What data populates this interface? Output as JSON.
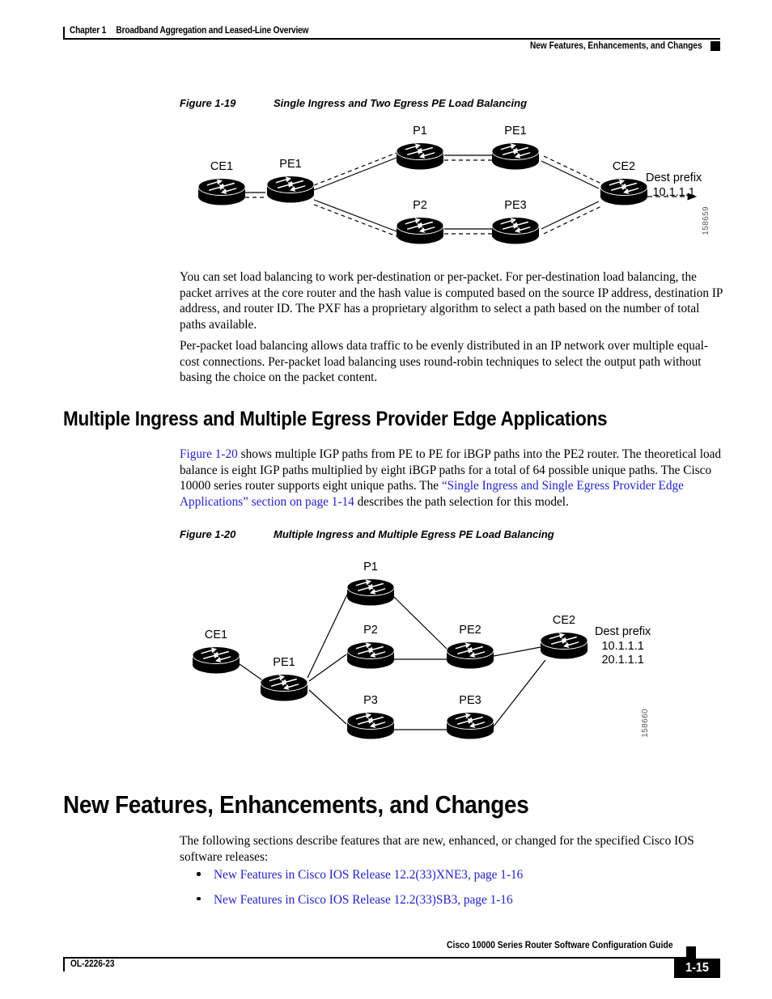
{
  "header": {
    "chapter_label": "Chapter 1",
    "chapter_title": "Broadband Aggregation and Leased-Line Overview",
    "section_title": "New Features, Enhancements, and Changes"
  },
  "figure_19": {
    "number": "Figure 1-19",
    "title": "Single Ingress and Two Egress PE Load Balancing",
    "figure_id": "158659",
    "nodes": [
      {
        "name": "CE1",
        "label": "CE1"
      },
      {
        "name": "PE1-ingress",
        "label": "PE1"
      },
      {
        "name": "P1",
        "label": "P1"
      },
      {
        "name": "P2",
        "label": "P2"
      },
      {
        "name": "PE1-egress",
        "label": "PE1"
      },
      {
        "name": "PE3",
        "label": "PE3"
      },
      {
        "name": "CE2",
        "label": "CE2"
      }
    ],
    "annotation": {
      "line1": "Dest prefix",
      "line2": "10.1.1.1"
    }
  },
  "paragraphs": {
    "per_destination": "You can set load balancing to work per-destination or per-packet. For per-destination load balancing, the packet arrives at the core router and the hash value is computed based on the source IP address, destination IP address, and router ID. The PXF has a proprietary algorithm to select a path based on the number of total paths available.",
    "per_packet": "Per-packet load balancing allows data traffic to be evenly distributed in an IP network over multiple equal-cost connections. Per-packet load balancing uses round-robin techniques to select the output path without basing the choice on the packet content."
  },
  "section_multiple": {
    "heading": "Multiple Ingress and Multiple Egress Provider Edge Applications",
    "intro": {
      "link_figure": "Figure 1-20",
      "text_1": " shows multiple IGP paths from PE to PE for iBGP paths into the PE2 router. The theoretical load balance is eight IGP paths multiplied by eight iBGP paths for a total of 64 possible unique paths. The Cisco 10000 series router supports eight unique paths. The ",
      "link_section": "“Single Ingress and Single Egress Provider Edge Applications” section on page 1-14",
      "text_2": " describes the path selection for this model."
    }
  },
  "figure_20": {
    "number": "Figure 1-20",
    "title": "Multiple Ingress and Multiple Egress PE Load Balancing",
    "figure_id": "158660",
    "nodes": [
      {
        "name": "CE1",
        "label": "CE1"
      },
      {
        "name": "PE1",
        "label": "PE1"
      },
      {
        "name": "P1",
        "label": "P1"
      },
      {
        "name": "P2",
        "label": "P2"
      },
      {
        "name": "P3",
        "label": "P3"
      },
      {
        "name": "PE2",
        "label": "PE2"
      },
      {
        "name": "PE3",
        "label": "PE3"
      },
      {
        "name": "CE2",
        "label": "CE2"
      }
    ],
    "annotation": {
      "line1": "Dest prefix",
      "line2": "10.1.1.1",
      "line3": "20.1.1.1"
    }
  },
  "section_new_features": {
    "heading": "New Features, Enhancements, and Changes",
    "intro": "The following sections describe features that are new, enhanced, or changed for the specified Cisco IOS software releases:",
    "bullets": [
      "New Features in Cisco IOS Release 12.2(33)XNE3, page 1-16",
      "New Features in Cisco IOS Release 12.2(33)SB3, page 1-16"
    ]
  },
  "footer": {
    "doc_id": "OL-2226-23",
    "guide_title": "Cisco 10000 Series Router Software Configuration Guide",
    "page_number": "1-15"
  }
}
